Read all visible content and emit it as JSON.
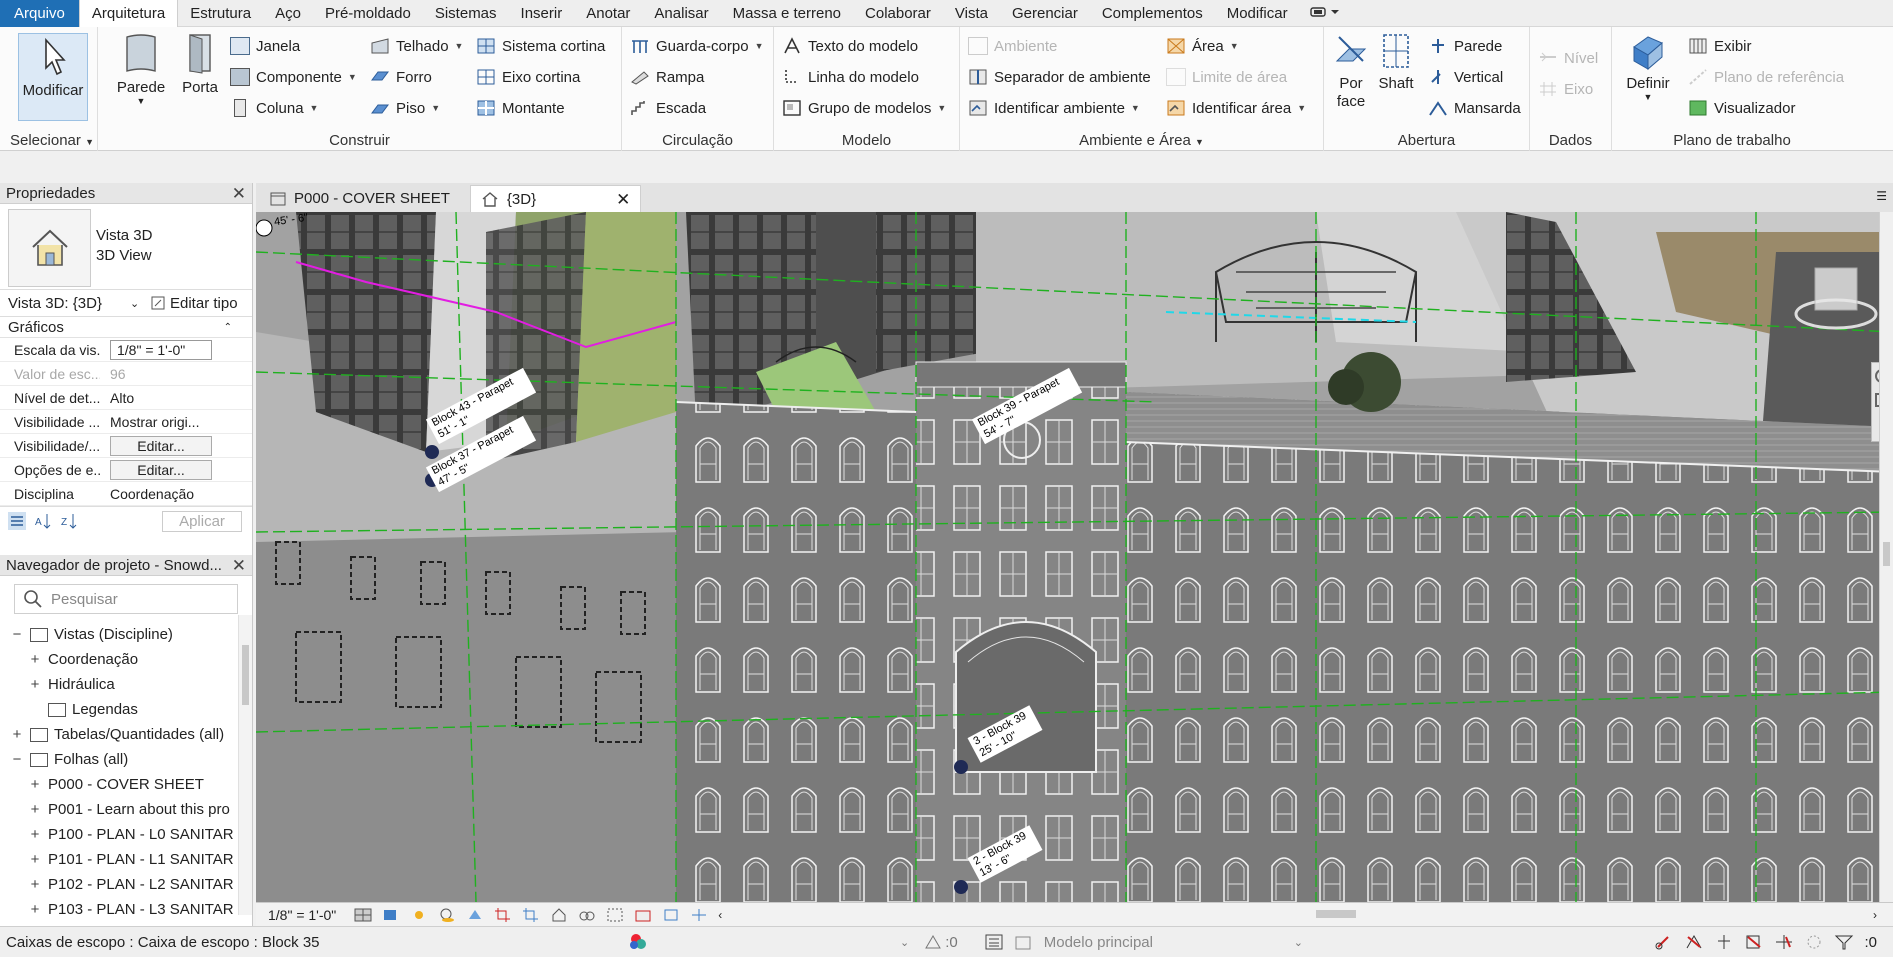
{
  "menu": {
    "file": "Arquivo",
    "tabs": [
      "Arquitetura",
      "Estrutura",
      "Aço",
      "Pré-moldado",
      "Sistemas",
      "Inserir",
      "Anotar",
      "Analisar",
      "Massa e terreno",
      "Colaborar",
      "Vista",
      "Gerenciar",
      "Complementos",
      "Modificar"
    ]
  },
  "ribbon": {
    "selecionar": {
      "modify": "Modificar",
      "title": "Selecionar"
    },
    "construir": {
      "title": "Construir",
      "parede": "Parede",
      "porta": "Porta",
      "janela": "Janela",
      "componente": "Componente",
      "coluna": "Coluna",
      "telhado": "Telhado",
      "forro": "Forro",
      "piso": "Piso",
      "sistema_cortina": "Sistema cortina",
      "eixo_cortina": "Eixo cortina",
      "montante": "Montante"
    },
    "circulacao": {
      "title": "Circulação",
      "guarda_corpo": "Guarda-corpo",
      "rampa": "Rampa",
      "escada": "Escada"
    },
    "modelo": {
      "title": "Modelo",
      "texto": "Texto do modelo",
      "linha": "Linha do modelo",
      "grupo": "Grupo de modelos"
    },
    "ambiente_area": {
      "title": "Ambiente e Área",
      "ambiente": "Ambiente",
      "separador": "Separador de ambiente",
      "identificar_ambiente": "Identificar ambiente",
      "area": "Área",
      "limite_area": "Limite de área",
      "identificar_area": "Identificar área"
    },
    "abertura": {
      "title": "Abertura",
      "por_face_1": "Por",
      "por_face_2": "face",
      "shaft": "Shaft",
      "parede": "Parede",
      "vertical": "Vertical",
      "mansarda": "Mansarda"
    },
    "dados": {
      "title": "Dados",
      "nivel": "Nível",
      "eixo": "Eixo"
    },
    "plano": {
      "title": "Plano de trabalho",
      "definir": "Definir",
      "exibir": "Exibir",
      "plano_ref": "Plano de referência",
      "visualizador": "Visualizador"
    }
  },
  "properties": {
    "title": "Propriedades",
    "type_line1": "Vista 3D",
    "type_line2": "3D View",
    "view_selector": "Vista 3D: {3D}",
    "edit_type": "Editar tipo",
    "section": "Gráficos",
    "rows": [
      {
        "key": "Escala da vis...",
        "value": "1/8\" = 1'-0\""
      },
      {
        "key": "Valor de esc...",
        "value": "96"
      },
      {
        "key": "Nível de det...",
        "value": "Alto"
      },
      {
        "key": "Visibilidade ...",
        "value": "Mostrar origi..."
      },
      {
        "key": "Visibilidade/...",
        "value": "Editar..."
      },
      {
        "key": "Opções de e...",
        "value": "Editar..."
      },
      {
        "key": "Disciplina",
        "value": "Coordenação"
      }
    ],
    "apply": "Aplicar"
  },
  "browser": {
    "title": "Navegador de projeto - Snowd...",
    "search_placeholder": "Pesquisar",
    "items": [
      {
        "label": "Vistas (Discipline)",
        "toggle": "−",
        "level": 0
      },
      {
        "label": "Coordenação",
        "toggle": "+",
        "level": 1
      },
      {
        "label": "Hidráulica",
        "toggle": "+",
        "level": 1
      },
      {
        "label": "Legendas",
        "toggle": "",
        "level": 1
      },
      {
        "label": "Tabelas/Quantidades (all)",
        "toggle": "+",
        "level": 0
      },
      {
        "label": "Folhas (all)",
        "toggle": "−",
        "level": 0
      },
      {
        "label": "P000 - COVER SHEET",
        "toggle": "+",
        "level": 1
      },
      {
        "label": "P001 - Learn about this pro",
        "toggle": "+",
        "level": 1
      },
      {
        "label": "P100 - PLAN - L0 SANITAR",
        "toggle": "+",
        "level": 1
      },
      {
        "label": "P101 - PLAN - L1 SANITAR",
        "toggle": "+",
        "level": 1
      },
      {
        "label": "P102 - PLAN - L2 SANITAR",
        "toggle": "+",
        "level": 1
      },
      {
        "label": "P103 - PLAN - L3 SANITAR",
        "toggle": "+",
        "level": 1
      }
    ]
  },
  "doctabs": [
    {
      "label": "P000 - COVER SHEET",
      "active": false
    },
    {
      "label": "{3D}",
      "active": true
    }
  ],
  "viewport": {
    "labels": {
      "level": "45' - 6\"",
      "b43": "Block 43 - Parapet",
      "b43_elev": "51' - 1\"",
      "b37": "Block 37 - Parapet",
      "b37_elev": "47' - 5\"",
      "b39": "Block 39 - Parapet",
      "b39_elev": "54' - 7\"",
      "l3": "3 - Block 39",
      "l3_elev": "25' - 10\"",
      "l2": "2 - Block 39",
      "l2_elev": "13' - 6\""
    }
  },
  "view_control": {
    "scale": "1/8\" = 1'-0\""
  },
  "status": {
    "text": "Caixas de escopo : Caixa de escopo : Block 35",
    "coord": ":0",
    "model": "Modelo principal",
    "filter": ":0"
  },
  "colors": {
    "file_tab": "#1f6fb5",
    "grid": "#2fa82f",
    "ribbon_bg": "#fbfbfb"
  }
}
